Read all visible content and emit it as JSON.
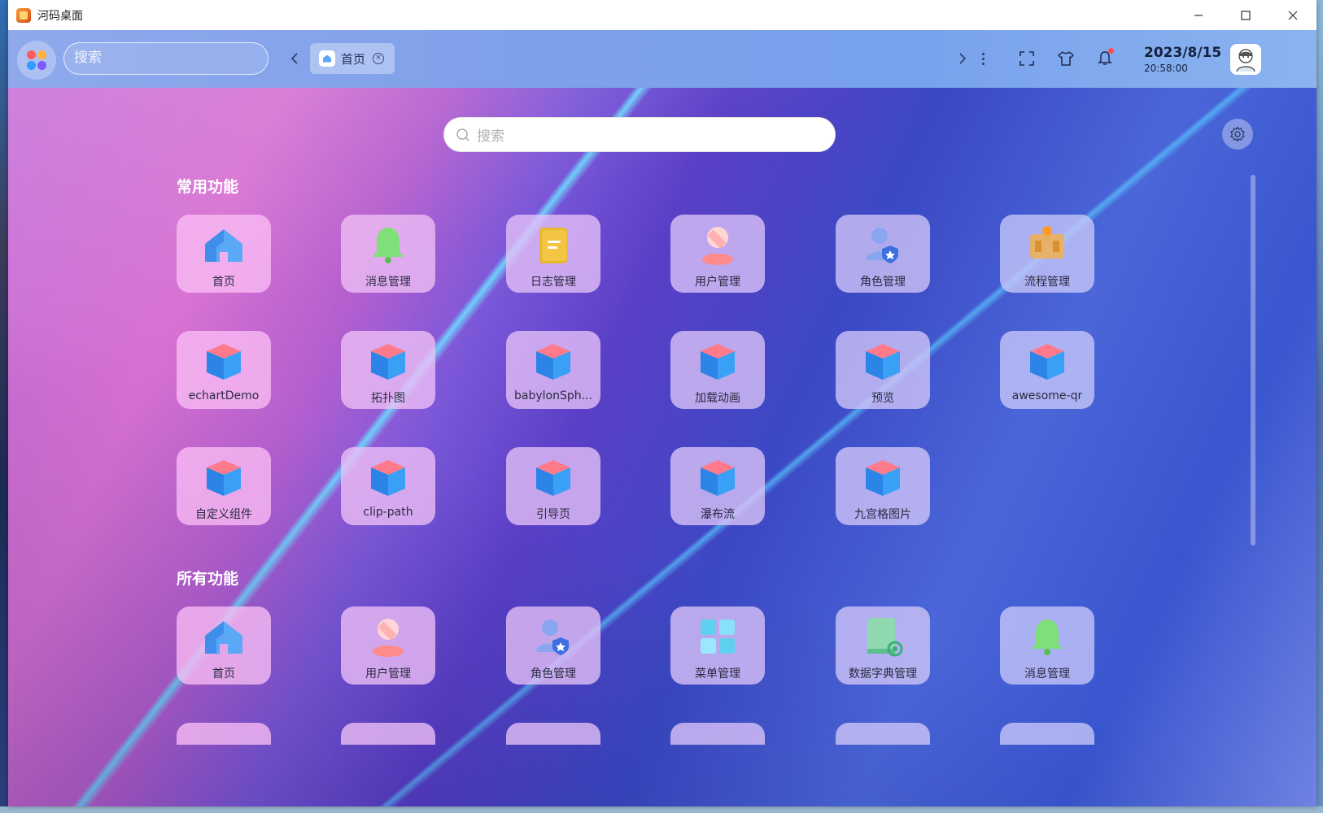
{
  "window": {
    "title": "河码桌面"
  },
  "taskbar": {
    "search_placeholder": "搜索",
    "tab_label": "首页",
    "date": "2023/8/15",
    "time": "20:58:00"
  },
  "main_search": {
    "placeholder": "搜索"
  },
  "sections": {
    "common": {
      "title": "常用功能",
      "items": [
        {
          "label": "首页",
          "icon": "home-icon"
        },
        {
          "label": "消息管理",
          "icon": "bell-icon"
        },
        {
          "label": "日志管理",
          "icon": "notebook-icon"
        },
        {
          "label": "用户管理",
          "icon": "user-icon"
        },
        {
          "label": "角色管理",
          "icon": "role-icon"
        },
        {
          "label": "流程管理",
          "icon": "flow-icon"
        },
        {
          "label": "echartDemo",
          "icon": "cube-icon"
        },
        {
          "label": "拓扑图",
          "icon": "cube-icon"
        },
        {
          "label": "babylonSph...",
          "icon": "cube-icon"
        },
        {
          "label": "加载动画",
          "icon": "cube-icon"
        },
        {
          "label": "预览",
          "icon": "cube-icon"
        },
        {
          "label": "awesome-qr",
          "icon": "cube-icon"
        },
        {
          "label": "自定义组件",
          "icon": "cube-icon"
        },
        {
          "label": "clip-path",
          "icon": "cube-icon"
        },
        {
          "label": "引导页",
          "icon": "cube-icon"
        },
        {
          "label": "瀑布流",
          "icon": "cube-icon"
        },
        {
          "label": "九宫格图片",
          "icon": "cube-icon"
        }
      ]
    },
    "all": {
      "title": "所有功能",
      "items": [
        {
          "label": "首页",
          "icon": "home-icon"
        },
        {
          "label": "用户管理",
          "icon": "user-icon"
        },
        {
          "label": "角色管理",
          "icon": "role-icon"
        },
        {
          "label": "菜单管理",
          "icon": "menu-grid-icon"
        },
        {
          "label": "数据字典管理",
          "icon": "dictionary-icon"
        },
        {
          "label": "消息管理",
          "icon": "bell-icon"
        }
      ]
    }
  },
  "colors": {
    "cube_top": "#ff7a8a",
    "cube_side": "#3aa0f5",
    "home": "#5aa8f6",
    "bell": "#7fe07a",
    "notebook": "#f4c542",
    "user": "#ff8a8a",
    "role": "#8aa6f0",
    "flow": "#f0b050"
  }
}
